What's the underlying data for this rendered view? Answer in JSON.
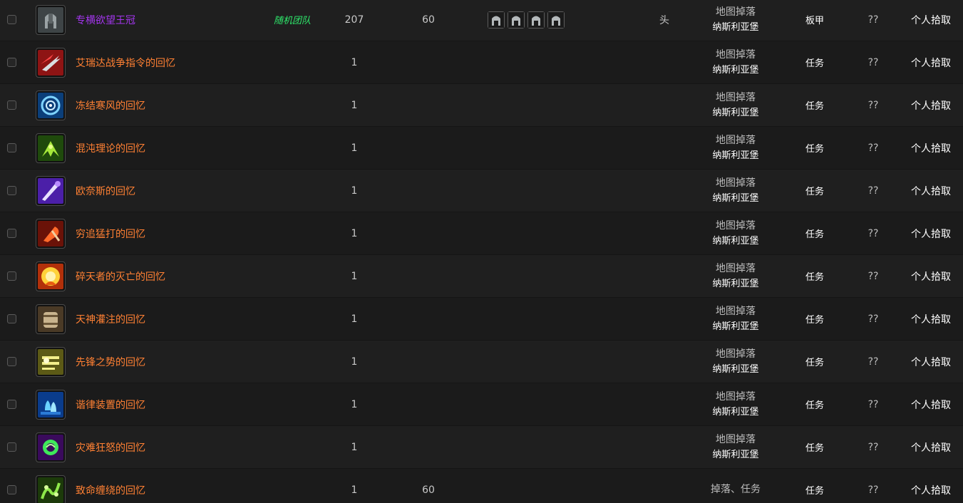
{
  "rows": [
    {
      "name": "专横欲望王冠",
      "quality": "epic",
      "source_tag": "随机团队",
      "level": "207",
      "req": "60",
      "set_icons": [
        "set-piece-icon",
        "set-piece-icon",
        "set-piece-icon",
        "set-piece-icon"
      ],
      "slot": "头",
      "drop_type": "地图掉落",
      "drop_zone": "纳斯利亚堡",
      "type": "板甲",
      "unknown": "??",
      "loot": "个人拾取",
      "icon": "plate-helm-icon",
      "icon_colors": [
        "#9aa2a4",
        "#3e4446"
      ]
    },
    {
      "name": "艾瑞达战争指令的回忆",
      "quality": "legendary",
      "source_tag": "",
      "level": "1",
      "req": "",
      "set_icons": [],
      "slot": "",
      "drop_type": "地图掉落",
      "drop_zone": "纳斯利亚堡",
      "type": "任务",
      "unknown": "??",
      "loot": "个人拾取",
      "icon": "claw-slash-icon",
      "icon_colors": [
        "#d8dde0",
        "#8e1414"
      ]
    },
    {
      "name": "冻结寒风的回忆",
      "quality": "legendary",
      "source_tag": "",
      "level": "1",
      "req": "",
      "set_icons": [],
      "slot": "",
      "drop_type": "地图掉落",
      "drop_zone": "纳斯利亚堡",
      "type": "任务",
      "unknown": "??",
      "loot": "个人拾取",
      "icon": "frost-swirl-icon",
      "icon_colors": [
        "#7fd4ff",
        "#0b3f7a"
      ]
    },
    {
      "name": "混沌理论的回忆",
      "quality": "legendary",
      "source_tag": "",
      "level": "1",
      "req": "",
      "set_icons": [],
      "slot": "",
      "drop_type": "地图掉落",
      "drop_zone": "纳斯利亚堡",
      "type": "任务",
      "unknown": "??",
      "loot": "个人拾取",
      "icon": "fel-wings-icon",
      "icon_colors": [
        "#a6e83a",
        "#1f4a0c"
      ]
    },
    {
      "name": "欧奈斯的回忆",
      "quality": "legendary",
      "source_tag": "",
      "level": "1",
      "req": "",
      "set_icons": [],
      "slot": "",
      "drop_type": "地图掉落",
      "drop_zone": "纳斯利亚堡",
      "type": "任务",
      "unknown": "??",
      "loot": "个人拾取",
      "icon": "arcane-bolt-icon",
      "icon_colors": [
        "#e8e2ff",
        "#4b1fa8"
      ]
    },
    {
      "name": "穷追猛打的回忆",
      "quality": "legendary",
      "source_tag": "",
      "level": "1",
      "req": "",
      "set_icons": [],
      "slot": "",
      "drop_type": "地图掉落",
      "drop_zone": "纳斯利亚堡",
      "type": "任务",
      "unknown": "??",
      "loot": "个人拾取",
      "icon": "axe-strike-icon",
      "icon_colors": [
        "#ff6a2a",
        "#6a1208"
      ]
    },
    {
      "name": "碎天者的灭亡的回忆",
      "quality": "legendary",
      "source_tag": "",
      "level": "1",
      "req": "",
      "set_icons": [],
      "slot": "",
      "drop_type": "地图掉落",
      "drop_zone": "纳斯利亚堡",
      "type": "任务",
      "unknown": "??",
      "loot": "个人拾取",
      "icon": "fire-burst-icon",
      "icon_colors": [
        "#ffd23a",
        "#b2300a"
      ]
    },
    {
      "name": "天神灌注的回忆",
      "quality": "legendary",
      "source_tag": "",
      "level": "1",
      "req": "",
      "set_icons": [],
      "slot": "",
      "drop_type": "地图掉落",
      "drop_zone": "纳斯利亚堡",
      "type": "任务",
      "unknown": "??",
      "loot": "个人拾取",
      "icon": "keg-icon",
      "icon_colors": [
        "#c9b48e",
        "#4a3a26"
      ]
    },
    {
      "name": "先锋之势的回忆",
      "quality": "legendary",
      "source_tag": "",
      "level": "1",
      "req": "",
      "set_icons": [],
      "slot": "",
      "drop_type": "地图掉落",
      "drop_zone": "纳斯利亚堡",
      "type": "任务",
      "unknown": "??",
      "loot": "个人拾取",
      "icon": "holy-rune-icon",
      "icon_colors": [
        "#f2ee8a",
        "#5c5a16"
      ]
    },
    {
      "name": "谐律装置的回忆",
      "quality": "legendary",
      "source_tag": "",
      "level": "1",
      "req": "",
      "set_icons": [],
      "slot": "",
      "drop_type": "地图掉落",
      "drop_zone": "纳斯利亚堡",
      "type": "任务",
      "unknown": "??",
      "loot": "个人拾取",
      "icon": "water-drops-icon",
      "icon_colors": [
        "#6ad2ff",
        "#0a3c8c"
      ]
    },
    {
      "name": "灾难狂怒的回忆",
      "quality": "legendary",
      "source_tag": "",
      "level": "1",
      "req": "",
      "set_icons": [],
      "slot": "",
      "drop_type": "地图掉落",
      "drop_zone": "纳斯利亚堡",
      "type": "任务",
      "unknown": "??",
      "loot": "个人拾取",
      "icon": "chaos-orb-icon",
      "icon_colors": [
        "#3ee85a",
        "#3a0a5c"
      ]
    },
    {
      "name": "致命缠绕的回忆",
      "quality": "legendary",
      "source_tag": "",
      "level": "1",
      "req": "60",
      "set_icons": [],
      "slot": "",
      "drop_type": "掉落、任务",
      "drop_zone": "",
      "type": "任务",
      "unknown": "??",
      "loot": "个人拾取",
      "icon": "poison-vines-icon",
      "icon_colors": [
        "#8ee84a",
        "#1c3a0a"
      ]
    }
  ]
}
